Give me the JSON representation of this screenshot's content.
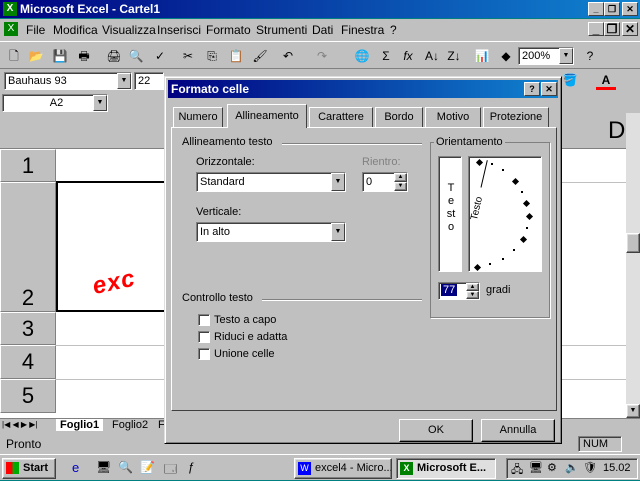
{
  "window": {
    "title": "Microsoft Excel - Cartel1"
  },
  "menu": [
    "File",
    "Modifica",
    "Visualizza",
    "Inserisci",
    "Formato",
    "Strumenti",
    "Dati",
    "Finestra",
    "?"
  ],
  "toolbar": {
    "zoom": "200%"
  },
  "format_bar": {
    "font": "Bauhaus 93",
    "size": "22"
  },
  "name_box": "A2",
  "grid": {
    "rows": [
      "1",
      "2",
      "3",
      "4",
      "5"
    ],
    "col_partial": "D",
    "cell_text": "exc"
  },
  "sheet_tabs": [
    "Foglio1",
    "Foglio2",
    "F"
  ],
  "status": {
    "ready": "Pronto",
    "num": "NUM"
  },
  "dialog": {
    "title": "Formato celle",
    "tabs": [
      "Numero",
      "Allineamento",
      "Carattere",
      "Bordo",
      "Motivo",
      "Protezione"
    ],
    "active_tab": "Allineamento",
    "text_alignment": {
      "group_label": "Allineamento testo",
      "horizontal_label": "Orizzontale:",
      "horizontal_value": "Standard",
      "indent_label": "Rientro:",
      "indent_value": "0",
      "vertical_label": "Verticale:",
      "vertical_value": "In alto"
    },
    "orientation": {
      "group_label": "Orientamento",
      "vertical_text": "Testo",
      "rotated_text": "Testo",
      "degrees_value": "77",
      "degrees_label": "gradi"
    },
    "text_control": {
      "group_label": "Controllo testo",
      "wrap": "Testo a capo",
      "shrink": "Riduci e adatta",
      "merge": "Unione celle"
    },
    "ok_label": "OK",
    "cancel_label": "Annulla"
  },
  "taskbar": {
    "start": "Start",
    "tasks": [
      "excel4 - Micro...",
      "Microsoft E..."
    ],
    "clock": "15.02"
  },
  "colors": {
    "title_bar": "#000080",
    "face": "#c0c0c0",
    "cell_text": "#ff0000"
  }
}
